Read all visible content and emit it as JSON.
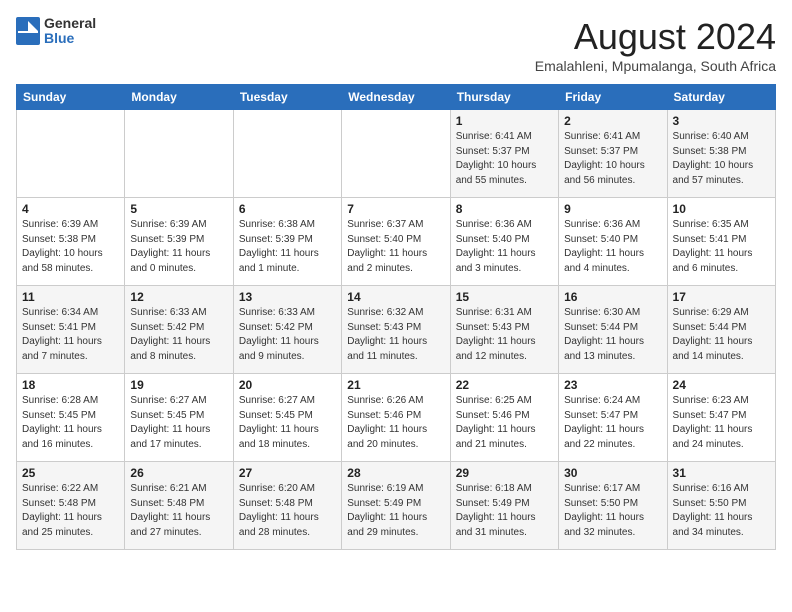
{
  "logo": {
    "general": "General",
    "blue": "Blue"
  },
  "title": "August 2024",
  "subtitle": "Emalahleni, Mpumalanga, South Africa",
  "days_of_week": [
    "Sunday",
    "Monday",
    "Tuesday",
    "Wednesday",
    "Thursday",
    "Friday",
    "Saturday"
  ],
  "weeks": [
    [
      {
        "day": "",
        "info": ""
      },
      {
        "day": "",
        "info": ""
      },
      {
        "day": "",
        "info": ""
      },
      {
        "day": "",
        "info": ""
      },
      {
        "day": "1",
        "info": "Sunrise: 6:41 AM\nSunset: 5:37 PM\nDaylight: 10 hours\nand 55 minutes."
      },
      {
        "day": "2",
        "info": "Sunrise: 6:41 AM\nSunset: 5:37 PM\nDaylight: 10 hours\nand 56 minutes."
      },
      {
        "day": "3",
        "info": "Sunrise: 6:40 AM\nSunset: 5:38 PM\nDaylight: 10 hours\nand 57 minutes."
      }
    ],
    [
      {
        "day": "4",
        "info": "Sunrise: 6:39 AM\nSunset: 5:38 PM\nDaylight: 10 hours\nand 58 minutes."
      },
      {
        "day": "5",
        "info": "Sunrise: 6:39 AM\nSunset: 5:39 PM\nDaylight: 11 hours\nand 0 minutes."
      },
      {
        "day": "6",
        "info": "Sunrise: 6:38 AM\nSunset: 5:39 PM\nDaylight: 11 hours\nand 1 minute."
      },
      {
        "day": "7",
        "info": "Sunrise: 6:37 AM\nSunset: 5:40 PM\nDaylight: 11 hours\nand 2 minutes."
      },
      {
        "day": "8",
        "info": "Sunrise: 6:36 AM\nSunset: 5:40 PM\nDaylight: 11 hours\nand 3 minutes."
      },
      {
        "day": "9",
        "info": "Sunrise: 6:36 AM\nSunset: 5:40 PM\nDaylight: 11 hours\nand 4 minutes."
      },
      {
        "day": "10",
        "info": "Sunrise: 6:35 AM\nSunset: 5:41 PM\nDaylight: 11 hours\nand 6 minutes."
      }
    ],
    [
      {
        "day": "11",
        "info": "Sunrise: 6:34 AM\nSunset: 5:41 PM\nDaylight: 11 hours\nand 7 minutes."
      },
      {
        "day": "12",
        "info": "Sunrise: 6:33 AM\nSunset: 5:42 PM\nDaylight: 11 hours\nand 8 minutes."
      },
      {
        "day": "13",
        "info": "Sunrise: 6:33 AM\nSunset: 5:42 PM\nDaylight: 11 hours\nand 9 minutes."
      },
      {
        "day": "14",
        "info": "Sunrise: 6:32 AM\nSunset: 5:43 PM\nDaylight: 11 hours\nand 11 minutes."
      },
      {
        "day": "15",
        "info": "Sunrise: 6:31 AM\nSunset: 5:43 PM\nDaylight: 11 hours\nand 12 minutes."
      },
      {
        "day": "16",
        "info": "Sunrise: 6:30 AM\nSunset: 5:44 PM\nDaylight: 11 hours\nand 13 minutes."
      },
      {
        "day": "17",
        "info": "Sunrise: 6:29 AM\nSunset: 5:44 PM\nDaylight: 11 hours\nand 14 minutes."
      }
    ],
    [
      {
        "day": "18",
        "info": "Sunrise: 6:28 AM\nSunset: 5:45 PM\nDaylight: 11 hours\nand 16 minutes."
      },
      {
        "day": "19",
        "info": "Sunrise: 6:27 AM\nSunset: 5:45 PM\nDaylight: 11 hours\nand 17 minutes."
      },
      {
        "day": "20",
        "info": "Sunrise: 6:27 AM\nSunset: 5:45 PM\nDaylight: 11 hours\nand 18 minutes."
      },
      {
        "day": "21",
        "info": "Sunrise: 6:26 AM\nSunset: 5:46 PM\nDaylight: 11 hours\nand 20 minutes."
      },
      {
        "day": "22",
        "info": "Sunrise: 6:25 AM\nSunset: 5:46 PM\nDaylight: 11 hours\nand 21 minutes."
      },
      {
        "day": "23",
        "info": "Sunrise: 6:24 AM\nSunset: 5:47 PM\nDaylight: 11 hours\nand 22 minutes."
      },
      {
        "day": "24",
        "info": "Sunrise: 6:23 AM\nSunset: 5:47 PM\nDaylight: 11 hours\nand 24 minutes."
      }
    ],
    [
      {
        "day": "25",
        "info": "Sunrise: 6:22 AM\nSunset: 5:48 PM\nDaylight: 11 hours\nand 25 minutes."
      },
      {
        "day": "26",
        "info": "Sunrise: 6:21 AM\nSunset: 5:48 PM\nDaylight: 11 hours\nand 27 minutes."
      },
      {
        "day": "27",
        "info": "Sunrise: 6:20 AM\nSunset: 5:48 PM\nDaylight: 11 hours\nand 28 minutes."
      },
      {
        "day": "28",
        "info": "Sunrise: 6:19 AM\nSunset: 5:49 PM\nDaylight: 11 hours\nand 29 minutes."
      },
      {
        "day": "29",
        "info": "Sunrise: 6:18 AM\nSunset: 5:49 PM\nDaylight: 11 hours\nand 31 minutes."
      },
      {
        "day": "30",
        "info": "Sunrise: 6:17 AM\nSunset: 5:50 PM\nDaylight: 11 hours\nand 32 minutes."
      },
      {
        "day": "31",
        "info": "Sunrise: 6:16 AM\nSunset: 5:50 PM\nDaylight: 11 hours\nand 34 minutes."
      }
    ]
  ]
}
